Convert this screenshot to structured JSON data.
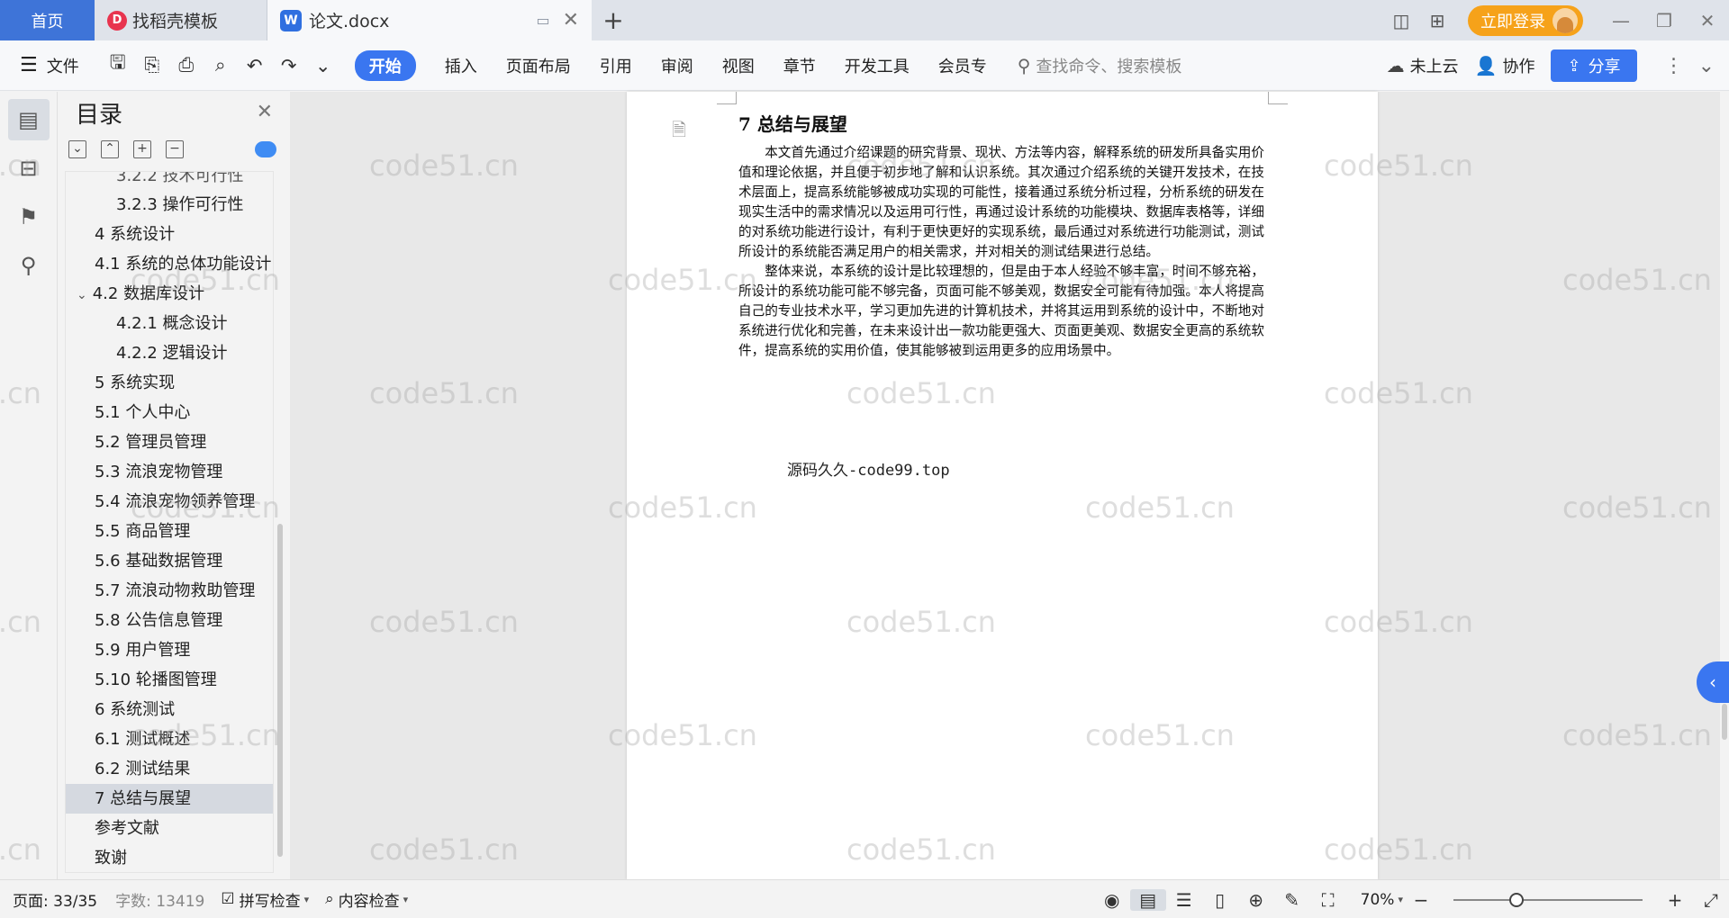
{
  "titlebar": {
    "home_tab": "首页",
    "templates_tab": "找稻壳模板",
    "doc_tab": "论文.docx",
    "login_label": "立即登录"
  },
  "ribbon": {
    "file_label": "文件",
    "tabs": [
      "开始",
      "插入",
      "页面布局",
      "引用",
      "审阅",
      "视图",
      "章节",
      "开发工具",
      "会员专"
    ],
    "search_placeholder": "查找命令、搜索模板",
    "cloud_label": "未上云",
    "collab_label": "协作",
    "share_label": "分享"
  },
  "toc": {
    "title": "目录",
    "items": [
      {
        "label": "3.2.2 技术可行性",
        "level": 3
      },
      {
        "label": "3.2.3 操作可行性",
        "level": 3
      },
      {
        "label": "4 系统设计",
        "level": 1
      },
      {
        "label": "4.1 系统的总体功能设计",
        "level": 2
      },
      {
        "label": "4.2 数据库设计",
        "level": 2
      },
      {
        "label": "4.2.1 概念设计",
        "level": 3
      },
      {
        "label": "4.2.2 逻辑设计",
        "level": 3
      },
      {
        "label": "5 系统实现",
        "level": 1
      },
      {
        "label": "5.1 个人中心",
        "level": 2
      },
      {
        "label": "5.2 管理员管理",
        "level": 2
      },
      {
        "label": "5.3 流浪宠物管理",
        "level": 2
      },
      {
        "label": "5.4 流浪宠物领养管理",
        "level": 2
      },
      {
        "label": "5.5 商品管理",
        "level": 2
      },
      {
        "label": "5.6 基础数据管理",
        "level": 2
      },
      {
        "label": "5.7 流浪动物救助管理",
        "level": 2
      },
      {
        "label": "5.8 公告信息管理",
        "level": 2
      },
      {
        "label": "5.9 用户管理",
        "level": 2
      },
      {
        "label": "5.10 轮播图管理",
        "level": 2
      },
      {
        "label": "6 系统测试",
        "level": 1
      },
      {
        "label": "6.1 测试概述",
        "level": 2
      },
      {
        "label": "6.2 测试结果",
        "level": 2
      },
      {
        "label": "7 总结与展望",
        "level": 1
      },
      {
        "label": "参考文献",
        "level": 1
      },
      {
        "label": "致谢",
        "level": 1
      }
    ]
  },
  "document": {
    "heading": "7 总结与展望",
    "para1": "本文首先通过介绍课题的研究背景、现状、方法等内容，解释系统的研发所具备实用价值和理论依据，并且便于初步地了解和认识系统。其次通过介绍系统的关键开发技术，在技术层面上，提高系统能够被成功实现的可能性，接着通过系统分析过程，分析系统的研发在现实生活中的需求情况以及运用可行性，再通过设计系统的功能模块、数据库表格等，详细的对系统功能进行设计，有利于更快更好的实现系统，最后通过对系统进行功能测试，测试所设计的系统能否满足用户的相关需求，并对相关的测试结果进行总结。",
    "para2": "整体来说，本系统的设计是比较理想的，但是由于本人经验不够丰富，时间不够充裕，所设计的系统功能可能不够完备，页面可能不够美观，数据安全可能有待加强。本人将提高自己的专业技术水平，学习更加先进的计算机技术，并将其运用到系统的设计中，不断地对系统进行优化和完善，在未来设计出一款功能更强大、页面更美观、数据安全更高的系统软件，提高系统的实用价值，使其能够被到运用更多的应用场景中。",
    "source_note": "源码久久-code99.top"
  },
  "watermark": "code51.cn",
  "statusbar": {
    "page": "页面: 33/35",
    "words": "字数: 13419",
    "spell_check": "拼写检查",
    "content_check": "内容检查",
    "zoom": "70%"
  },
  "colors": {
    "accent": "#3a76f0",
    "home_tab": "#3e74d8",
    "login": "#f6a21a"
  }
}
